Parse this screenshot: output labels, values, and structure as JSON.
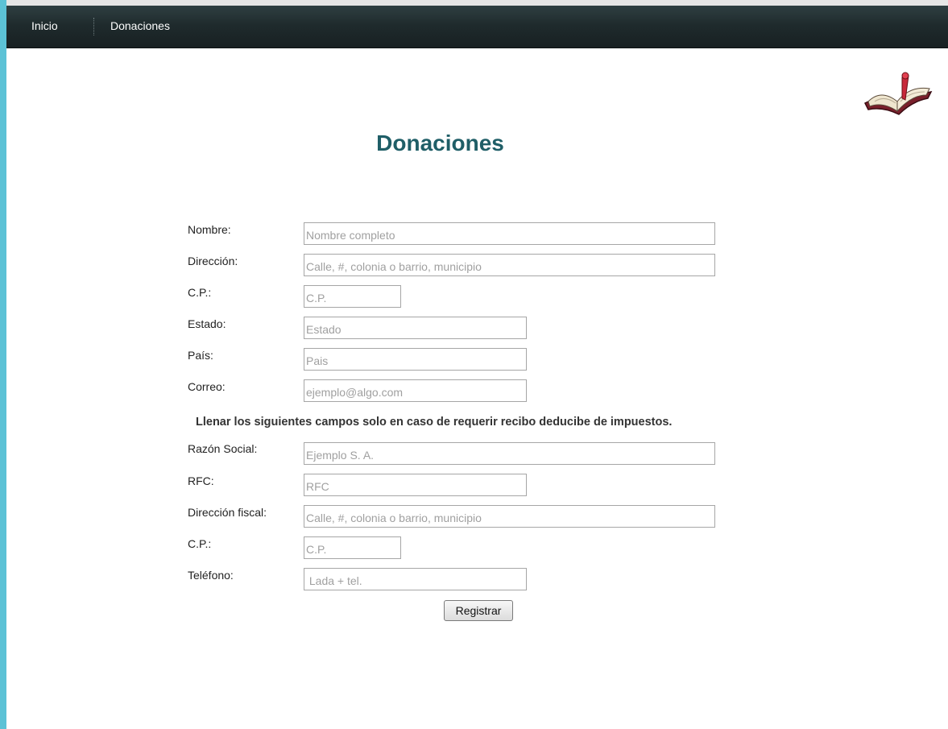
{
  "nav": {
    "items": [
      {
        "label": "Inicio"
      },
      {
        "label": "Donaciones"
      }
    ]
  },
  "header": {
    "logo_icon": "open-book-icon"
  },
  "page": {
    "title": "Donaciones"
  },
  "form": {
    "nombre": {
      "label": "Nombre:",
      "placeholder": "Nombre completo"
    },
    "direccion": {
      "label": "Dirección:",
      "placeholder": "Calle, #, colonia o barrio, municipio"
    },
    "cp": {
      "label": "C.P.:",
      "placeholder": "C.P."
    },
    "estado": {
      "label": "Estado:",
      "placeholder": "Estado"
    },
    "pais": {
      "label": "País:",
      "placeholder": "Pais"
    },
    "correo": {
      "label": "Correo:",
      "placeholder": "ejemplo@algo.com"
    },
    "note": "Llenar los siguientes campos solo en caso de requerir recibo deducibe de impuestos.",
    "razon_social": {
      "label": "Razón Social:",
      "placeholder": "Ejemplo S. A."
    },
    "rfc": {
      "label": "RFC:",
      "placeholder": "RFC"
    },
    "direccion_fiscal": {
      "label": "Dirección fiscal:",
      "placeholder": "Calle, #, colonia o barrio, municipio"
    },
    "cp_fiscal": {
      "label": "C.P.:",
      "placeholder": "C.P."
    },
    "telefono": {
      "label": "Teléfono:",
      "placeholder": " Lada + tel."
    },
    "submit_label": "Registrar"
  },
  "colors": {
    "nav_bg": "#1f2b2d",
    "left_accent": "#5cc2d6",
    "title": "#1f5e67"
  }
}
